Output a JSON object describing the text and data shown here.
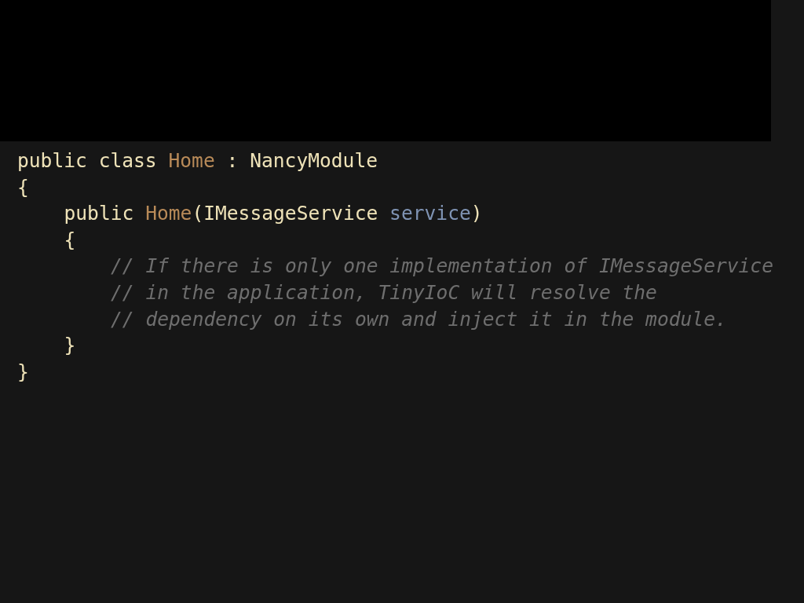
{
  "code": {
    "lines": [
      {
        "tokens": [
          {
            "text": "public class ",
            "kind": "keyword"
          },
          {
            "text": "Home",
            "kind": "name"
          },
          {
            "text": " : ",
            "kind": "plain"
          },
          {
            "text": "NancyModule",
            "kind": "type"
          }
        ]
      },
      {
        "tokens": [
          {
            "text": "{",
            "kind": "plain"
          }
        ],
        "children": [
          {
            "tokens": [
              {
                "text": "public ",
                "kind": "keyword"
              },
              {
                "text": "Home",
                "kind": "name"
              },
              {
                "text": "(IMessageService ",
                "kind": "plain"
              },
              {
                "text": "service",
                "kind": "param"
              },
              {
                "text": ")",
                "kind": "plain"
              }
            ]
          },
          {
            "tokens": [
              {
                "text": "{",
                "kind": "plain"
              }
            ],
            "children": [
              {
                "tokens": [
                  {
                    "text": "// If there is only one implementation of IMessageService",
                    "kind": "comment"
                  }
                ]
              },
              {
                "tokens": [
                  {
                    "text": "// in the application, TinyIoC will resolve the",
                    "kind": "comment"
                  }
                ]
              },
              {
                "tokens": [
                  {
                    "text": "// dependency on its own and inject it in the module.",
                    "kind": "comment"
                  }
                ]
              }
            ]
          },
          {
            "tokens": [
              {
                "text": "}",
                "kind": "plain"
              }
            ]
          }
        ]
      },
      {
        "tokens": [
          {
            "text": "}",
            "kind": "plain"
          }
        ]
      }
    ]
  }
}
